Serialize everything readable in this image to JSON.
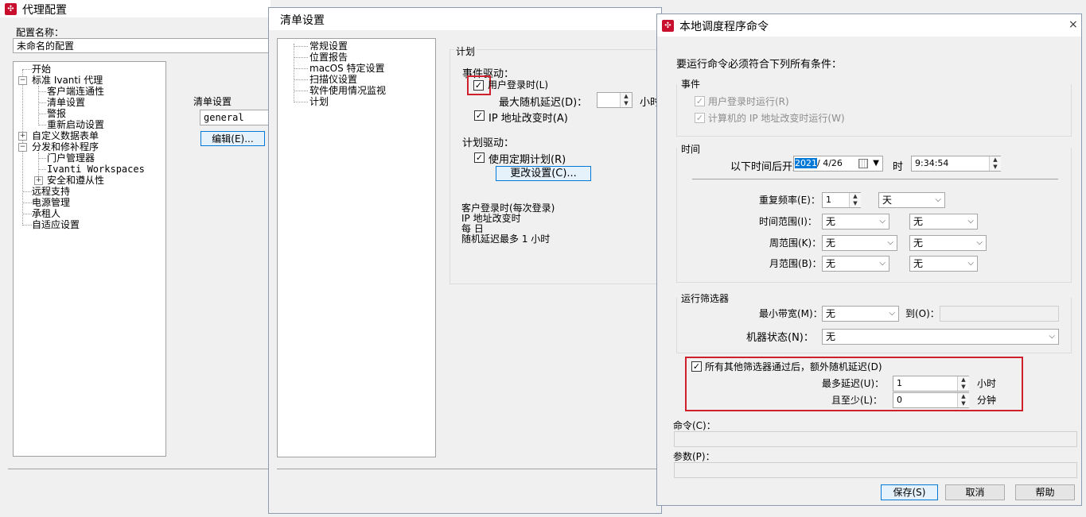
{
  "agent_config": {
    "title": "代理配置",
    "config_name_label": "配置名称：",
    "config_name_value": "未命名的配置",
    "tree": {
      "start": "开始",
      "standard_agent": "标准 Ivanti 代理",
      "client_connectivity": "客户端连通性",
      "inventory_settings": "清单设置",
      "alerts": "警报",
      "reboot_settings": "重新启动设置",
      "custom_data_forms": "自定义数据表单",
      "distribution_patch": "分发和修补程序",
      "portal_manager": "门户管理器",
      "ivanti_workspaces": "Ivanti Workspaces",
      "security_compliance": "安全和遵从性",
      "remote_support": "远程支持",
      "power_management": "电源管理",
      "tenant": "承租人",
      "adaptive_settings": "自适应设置"
    },
    "inventory_section_label": "清单设置",
    "inventory_dropdown_value": "general",
    "edit_button": "编辑(E)..."
  },
  "inventory_settings": {
    "title": "清单设置",
    "tree": [
      "常规设置",
      "位置报告",
      "macOS 特定设置",
      "扫描仪设置",
      "软件使用情况监视",
      "计划"
    ],
    "schedule_group": "计划",
    "event_driven": "事件驱动：",
    "user_login": "用户登录时(L)",
    "max_random_delay": "最大随机延迟(D)：",
    "hours_short": "小时",
    "ip_changed": "IP 地址改变时(A)",
    "schedule_driven": "计划驱动：",
    "use_schedule": "使用定期计划(R)",
    "change_settings_button": "更改设置(C)...",
    "summary": [
      "客户登录时(每次登录)",
      "IP 地址改变时",
      "每 日",
      "随机延迟最多 1 小时"
    ]
  },
  "local_scheduler": {
    "title": "本地调度程序命令",
    "close_icon": "×",
    "intro": "要运行命令必须符合下列所有条件：",
    "events_group": "事件",
    "run_on_user_login": "用户登录时运行(R)",
    "run_on_ip_change": "计算机的 IP 地址改变时运行(W)",
    "time_group": "时间",
    "start_after_label": "以下时间后开始",
    "date_year_selected": "2021",
    "date_rest": "/ 4/26",
    "time_label": "时",
    "time_value": "9:34:54",
    "repeat_freq_label": "重复频率(E)：",
    "repeat_freq_value": "1",
    "repeat_unit_value": "天",
    "time_range_label": "时间范围(I)：",
    "week_range_label": "周范围(K)：",
    "month_range_label": "月范围(B)：",
    "none": "无",
    "run_filter_group": "运行筛选器",
    "min_bandwidth_label": "最小带宽(M)：",
    "to_label": "到(O)：",
    "machine_state_label": "机器状态(N)：",
    "extra_delay_label": "所有其他筛选器通过后，额外随机延迟(D)",
    "max_delay_label": "最多延迟(U)：",
    "max_delay_value": "1",
    "max_delay_unit": "小时",
    "min_delay_label": "且至少(L)：",
    "min_delay_value": "0",
    "min_delay_unit": "分钟",
    "command_label": "命令(C)：",
    "params_label": "参数(P)：",
    "save_button": "保存(S)",
    "cancel_button": "取消",
    "help_button": "帮助"
  }
}
